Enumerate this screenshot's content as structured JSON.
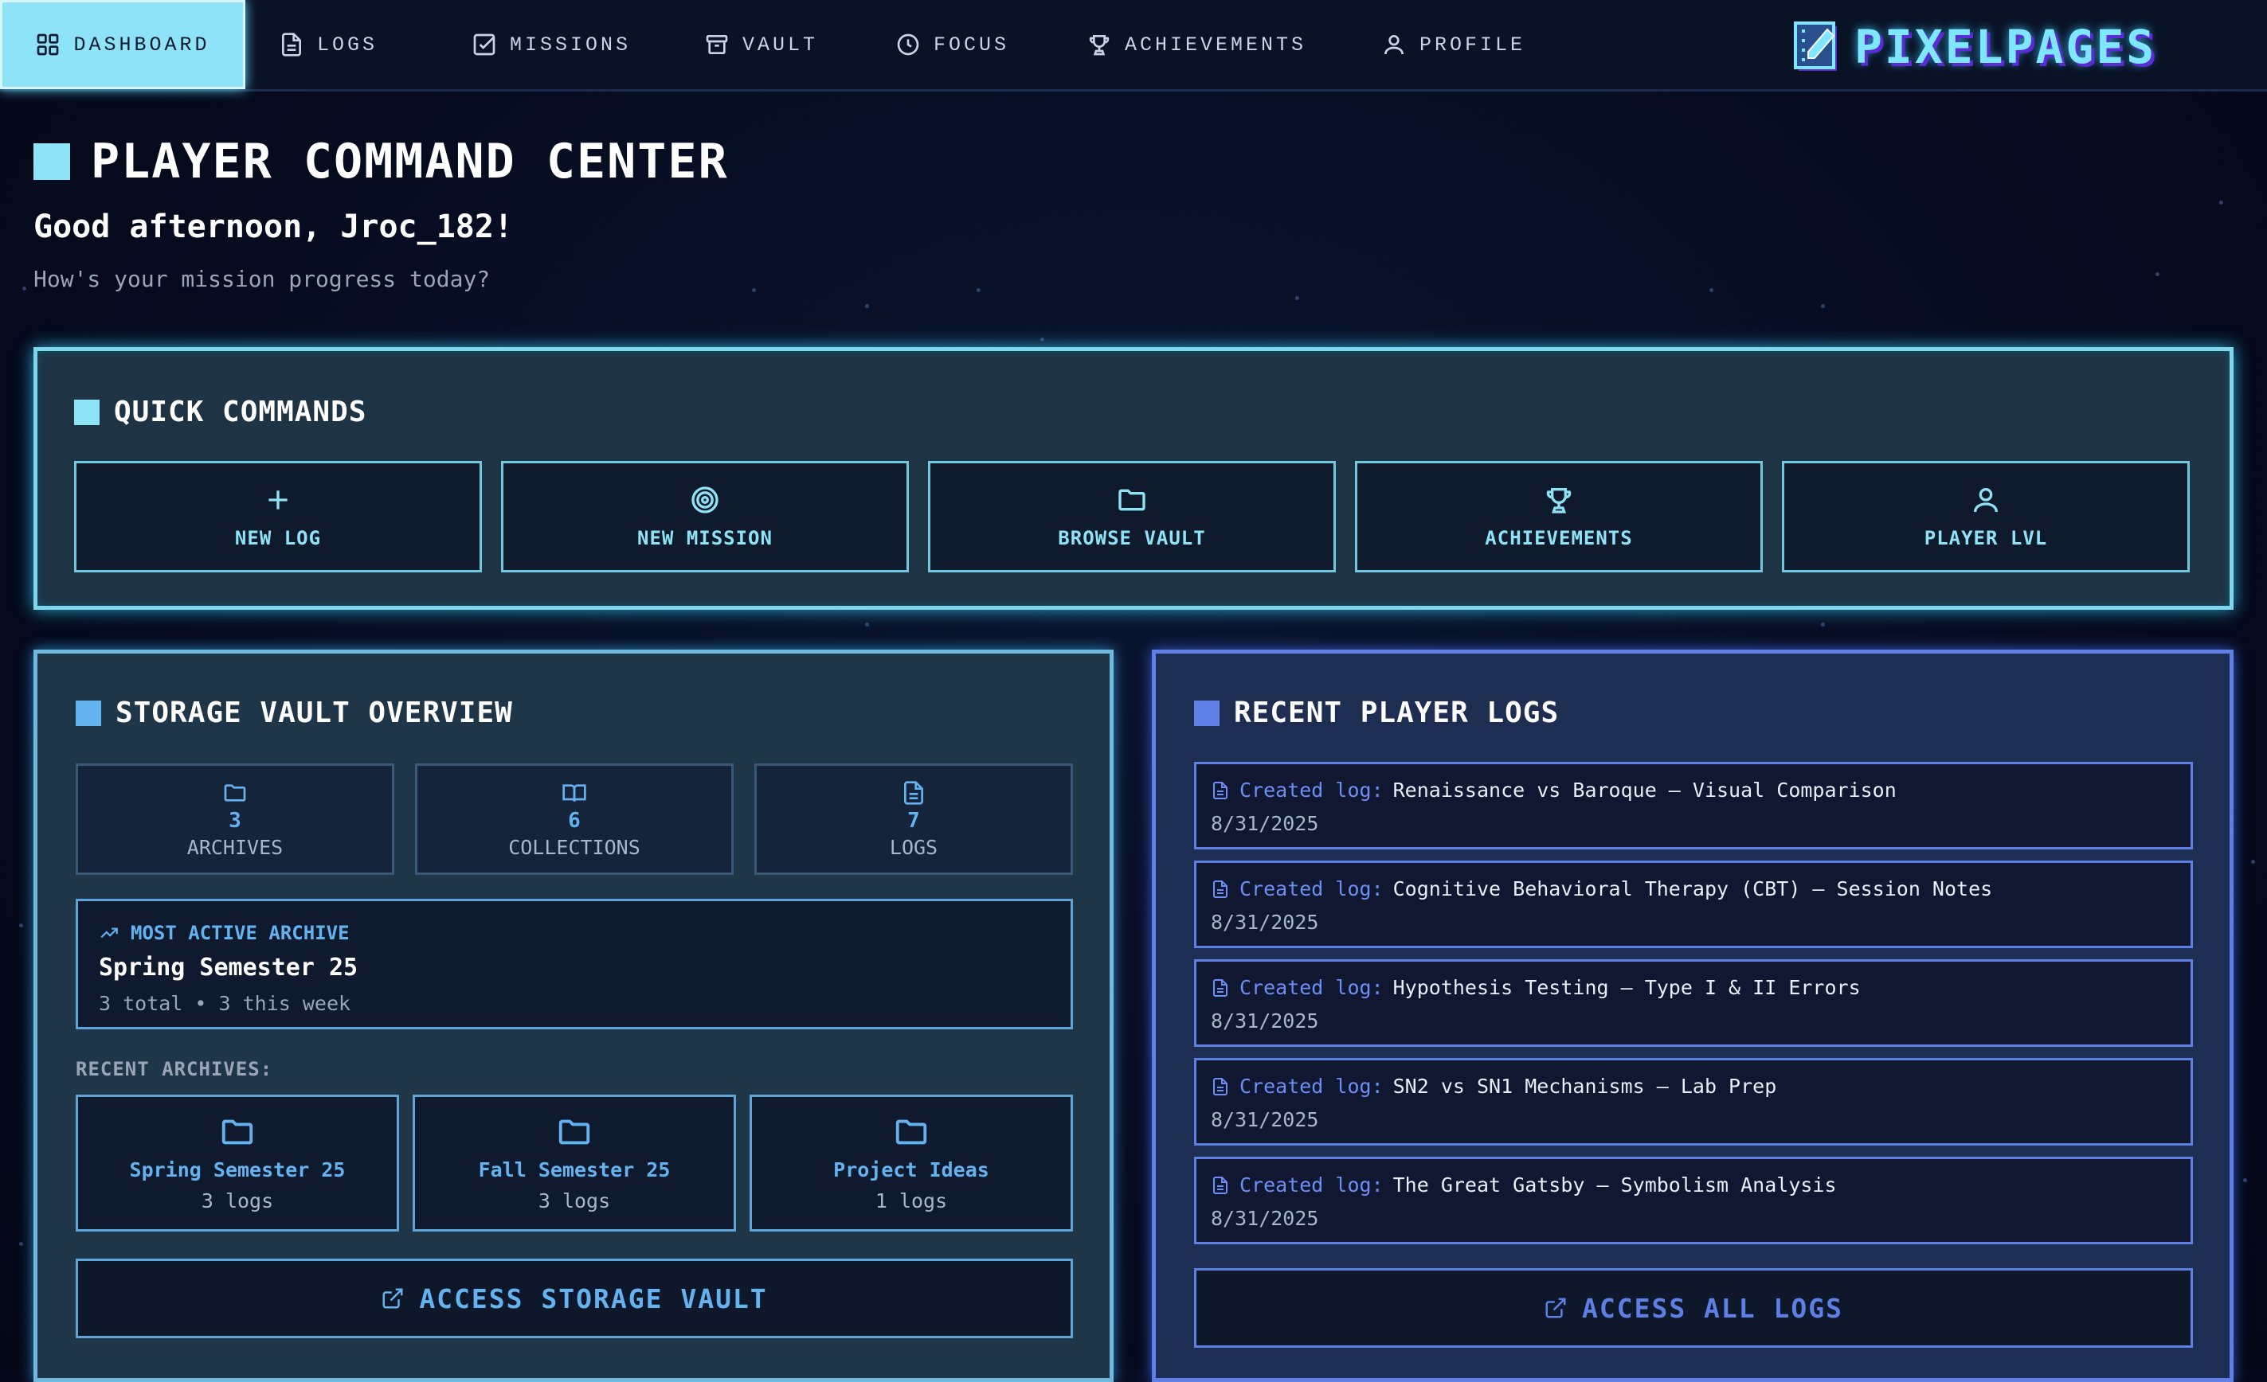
{
  "nav": {
    "items": [
      {
        "label": "DASHBOARD",
        "icon": "grid-icon",
        "active": true
      },
      {
        "label": "LOGS",
        "icon": "file-icon"
      },
      {
        "label": "MISSIONS",
        "icon": "checkbox-icon"
      },
      {
        "label": "VAULT",
        "icon": "archive-icon"
      },
      {
        "label": "FOCUS",
        "icon": "clock-icon"
      },
      {
        "label": "ACHIEVEMENTS",
        "icon": "trophy-icon"
      },
      {
        "label": "PROFILE",
        "icon": "user-icon"
      }
    ],
    "brand": "PIXELPAGES"
  },
  "header": {
    "title": "PLAYER COMMAND CENTER",
    "greeting": "Good afternoon, Jroc_182!",
    "subtitle": "How's your mission progress today?"
  },
  "quick_commands": {
    "title": "QUICK COMMANDS",
    "buttons": [
      {
        "label": "NEW LOG",
        "icon": "plus-icon"
      },
      {
        "label": "NEW MISSION",
        "icon": "target-icon"
      },
      {
        "label": "BROWSE VAULT",
        "icon": "folder-icon"
      },
      {
        "label": "ACHIEVEMENTS",
        "icon": "trophy-icon"
      },
      {
        "label": "PLAYER LVL",
        "icon": "user-icon"
      }
    ]
  },
  "vault": {
    "title": "STORAGE VAULT OVERVIEW",
    "stats": [
      {
        "value": "3",
        "label": "ARCHIVES",
        "icon": "folder-icon"
      },
      {
        "value": "6",
        "label": "COLLECTIONS",
        "icon": "book-icon"
      },
      {
        "value": "7",
        "label": "LOGS",
        "icon": "file-icon"
      }
    ],
    "most_active": {
      "heading": "MOST ACTIVE ARCHIVE",
      "name": "Spring Semester 25",
      "summary": "3 total • 3 this week"
    },
    "recent_label": "RECENT ARCHIVES:",
    "recent": [
      {
        "name": "Spring Semester 25",
        "count": "3 logs"
      },
      {
        "name": "Fall Semester 25",
        "count": "3 logs"
      },
      {
        "name": "Project Ideas",
        "count": "1 logs"
      }
    ],
    "access_label": "ACCESS STORAGE VAULT"
  },
  "logs": {
    "title": "RECENT PLAYER LOGS",
    "prefix": "Created log:",
    "items": [
      {
        "title": "Renaissance vs Baroque – Visual Comparison",
        "date": "8/31/2025"
      },
      {
        "title": "Cognitive Behavioral Therapy (CBT) – Session Notes",
        "date": "8/31/2025"
      },
      {
        "title": "Hypothesis Testing – Type I & II Errors",
        "date": "8/31/2025"
      },
      {
        "title": "SN2 vs SN1 Mechanisms – Lab Prep",
        "date": "8/31/2025"
      },
      {
        "title": "The Great Gatsby – Symbolism Analysis",
        "date": "8/31/2025"
      }
    ],
    "access_label": "ACCESS ALL LOGS"
  },
  "colors": {
    "accent_cyan": "#8fe3f7",
    "accent_blue": "#63b3f0",
    "accent_indigo": "#5d7fe6",
    "background": "#060b1f"
  }
}
